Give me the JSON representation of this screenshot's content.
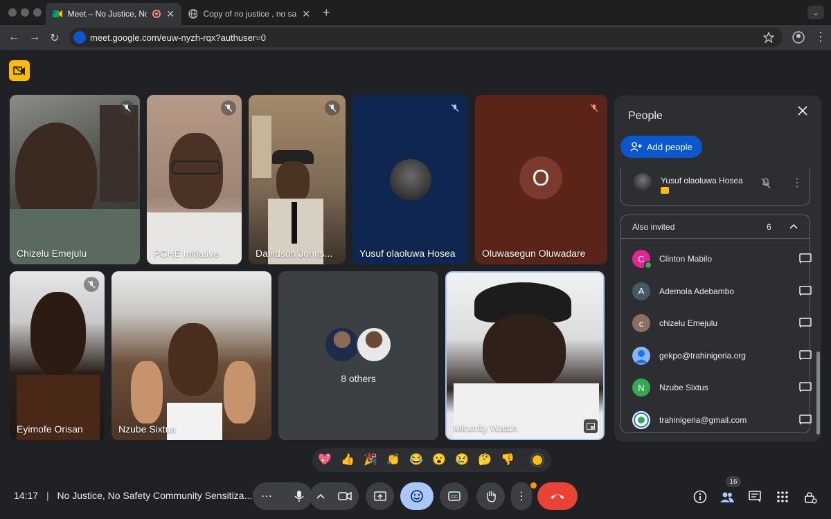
{
  "browser": {
    "tabs": [
      {
        "title": "Meet – No Justice, No Safety",
        "active": true
      },
      {
        "title": "Copy of no justice , no safety",
        "active": false
      }
    ],
    "url": "meet.google.com/euw-nyzh-rqx?authuser=0"
  },
  "tiles": [
    {
      "name": "Chizelu Emejulu",
      "type": "video"
    },
    {
      "name": "PCHE Initiative",
      "type": "video"
    },
    {
      "name": "Davidson Johns...",
      "type": "video"
    },
    {
      "name": "Yusuf olaoluwa Hosea",
      "type": "avatar"
    },
    {
      "name": "Oluwasegun Oluwadare",
      "type": "letter",
      "letter": "O"
    },
    {
      "name": "Eyimofe Orisan",
      "type": "video"
    },
    {
      "name": "Nzube Sixtus",
      "type": "video"
    },
    {
      "name": "8 others",
      "type": "group"
    },
    {
      "name": "Minority Watch",
      "type": "video"
    }
  ],
  "people_panel": {
    "title": "People",
    "add_button": "Add people",
    "in_call": [
      {
        "name": "Yusuf olaoluwa Hosea"
      }
    ],
    "also_invited": {
      "label": "Also invited",
      "count": "6",
      "people": [
        {
          "name": "Clinton Mabilo",
          "initial": "C",
          "color": "#e52592"
        },
        {
          "name": "Ademola Adebambo",
          "initial": "A",
          "color": "#455a64"
        },
        {
          "name": "chizelu Emejulu",
          "initial": "c",
          "color": "#8d6e63"
        },
        {
          "name": "gekpo@trahinigeria.org",
          "initial": "",
          "color": "#8ab4f8"
        },
        {
          "name": "Nzube Sixtus",
          "initial": "N",
          "color": "#34a853"
        },
        {
          "name": "trahinigeria@gmail.com",
          "initial": "",
          "color": "#ffffff"
        }
      ]
    }
  },
  "reactions": [
    "💖",
    "👍",
    "🎉",
    "👏",
    "😂",
    "😮",
    "😢",
    "🤔",
    "👎"
  ],
  "meeting": {
    "time": "14:17",
    "separator": "|",
    "title": "No Justice, No Safety Community Sensitiza..."
  },
  "badges": {
    "participants_count": "16"
  },
  "colors": {
    "accent": "#0b57d0",
    "end_call": "#ea4335",
    "reaction_active": "#a8c7fa"
  }
}
